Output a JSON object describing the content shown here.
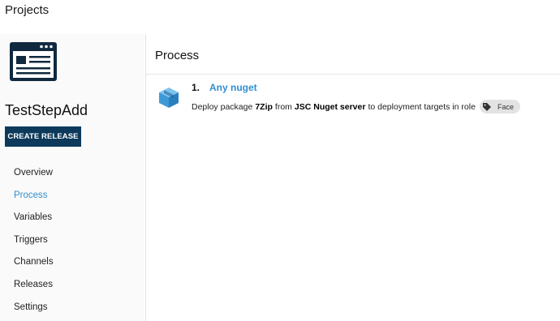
{
  "breadcrumb": {
    "label": "Projects"
  },
  "project": {
    "name": "TestStepAdd",
    "create_release_label": "CREATE RELEASE"
  },
  "nav": {
    "items": [
      {
        "label": "Overview",
        "active": false
      },
      {
        "label": "Process",
        "active": true
      },
      {
        "label": "Variables",
        "active": false
      },
      {
        "label": "Triggers",
        "active": false
      },
      {
        "label": "Channels",
        "active": false
      },
      {
        "label": "Releases",
        "active": false
      },
      {
        "label": "Settings",
        "active": false
      }
    ]
  },
  "process": {
    "title": "Process",
    "steps": [
      {
        "number": "1.",
        "name": "Any nuget",
        "icon": "package-icon",
        "desc_prefix": "Deploy package",
        "package": "7Zip",
        "desc_from": "from",
        "feed": "JSC Nuget server",
        "desc_suffix": "to deployment targets in role",
        "role": "Face"
      }
    ]
  },
  "colors": {
    "accent": "#2f8fd1",
    "button": "#0d3a5b",
    "sidebar_bg": "#fafafa",
    "chip_bg": "#e3e3e3",
    "package_blue": "#3d9ad6"
  }
}
